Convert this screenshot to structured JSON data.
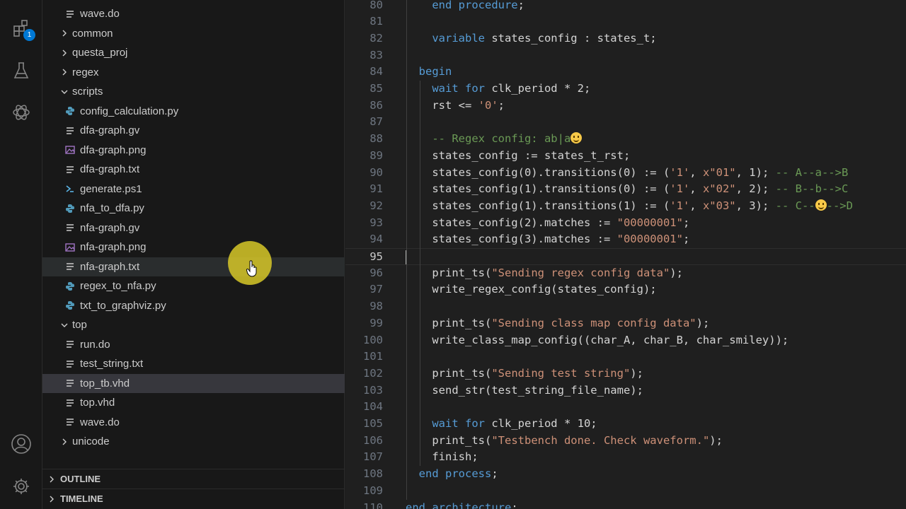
{
  "activity_bar": {
    "extensions_badge": "1",
    "icons": [
      "extensions-icon",
      "testing-icon",
      "chatgpt-icon",
      "account-icon",
      "settings-gear-icon"
    ]
  },
  "explorer": {
    "rows": [
      {
        "kind": "file",
        "icon": "lines",
        "name": "wave.do"
      },
      {
        "kind": "folder",
        "open": false,
        "name": "common"
      },
      {
        "kind": "folder",
        "open": false,
        "name": "questa_proj"
      },
      {
        "kind": "folder",
        "open": false,
        "name": "regex"
      },
      {
        "kind": "folder",
        "open": true,
        "name": "scripts"
      },
      {
        "kind": "file",
        "icon": "python",
        "name": "config_calculation.py"
      },
      {
        "kind": "file",
        "icon": "lines",
        "name": "dfa-graph.gv"
      },
      {
        "kind": "file",
        "icon": "image",
        "name": "dfa-graph.png"
      },
      {
        "kind": "file",
        "icon": "lines",
        "name": "dfa-graph.txt"
      },
      {
        "kind": "file",
        "icon": "powershell",
        "name": "generate.ps1"
      },
      {
        "kind": "file",
        "icon": "python",
        "name": "nfa_to_dfa.py"
      },
      {
        "kind": "file",
        "icon": "lines",
        "name": "nfa-graph.gv"
      },
      {
        "kind": "file",
        "icon": "image",
        "name": "nfa-graph.png"
      },
      {
        "kind": "file",
        "icon": "lines",
        "name": "nfa-graph.txt",
        "state": "hover"
      },
      {
        "kind": "file",
        "icon": "python",
        "name": "regex_to_nfa.py"
      },
      {
        "kind": "file",
        "icon": "python",
        "name": "txt_to_graphviz.py"
      },
      {
        "kind": "folder",
        "open": true,
        "name": "top"
      },
      {
        "kind": "file",
        "icon": "lines",
        "name": "run.do"
      },
      {
        "kind": "file",
        "icon": "lines",
        "name": "test_string.txt"
      },
      {
        "kind": "file",
        "icon": "lines",
        "name": "top_tb.vhd",
        "state": "selected"
      },
      {
        "kind": "file",
        "icon": "lines",
        "name": "top.vhd"
      },
      {
        "kind": "file",
        "icon": "lines",
        "name": "wave.do"
      },
      {
        "kind": "folder",
        "open": false,
        "name": "unicode"
      }
    ],
    "outline_label": "OUTLINE",
    "timeline_label": "TIMELINE"
  },
  "editor": {
    "current_line": 95,
    "lines": [
      {
        "n": "80",
        "indent": 2,
        "t": [
          [
            "kw",
            "end procedure"
          ],
          [
            "p",
            ";"
          ]
        ]
      },
      {
        "n": "81",
        "indent": 0,
        "t": []
      },
      {
        "n": "82",
        "indent": 2,
        "t": [
          [
            "kw",
            "variable"
          ],
          [
            "p",
            " states_config : states_t;"
          ]
        ]
      },
      {
        "n": "83",
        "indent": 0,
        "t": []
      },
      {
        "n": "84",
        "indent": 1,
        "t": [
          [
            "kw",
            "begin"
          ]
        ]
      },
      {
        "n": "85",
        "indent": 2,
        "t": [
          [
            "kw",
            "wait for"
          ],
          [
            "p",
            " clk_period * 2;"
          ]
        ]
      },
      {
        "n": "86",
        "indent": 2,
        "t": [
          [
            "p",
            "rst <= "
          ],
          [
            "str",
            "'0'"
          ],
          [
            "p",
            ";"
          ]
        ]
      },
      {
        "n": "87",
        "indent": 0,
        "t": []
      },
      {
        "n": "88",
        "indent": 2,
        "t": [
          [
            "cm",
            "-- Regex config: ab|a"
          ],
          [
            "emoji",
            ""
          ]
        ]
      },
      {
        "n": "89",
        "indent": 2,
        "t": [
          [
            "p",
            "states_config := states_t_rst;"
          ]
        ]
      },
      {
        "n": "90",
        "indent": 2,
        "t": [
          [
            "p",
            "states_config(0).transitions(0) := ("
          ],
          [
            "str",
            "'1'"
          ],
          [
            "p",
            ", "
          ],
          [
            "str",
            "x\"01\""
          ],
          [
            "p",
            ", 1); "
          ],
          [
            "cm",
            "-- A--a-->B"
          ]
        ]
      },
      {
        "n": "91",
        "indent": 2,
        "t": [
          [
            "p",
            "states_config(1).transitions(0) := ("
          ],
          [
            "str",
            "'1'"
          ],
          [
            "p",
            ", "
          ],
          [
            "str",
            "x\"02\""
          ],
          [
            "p",
            ", 2); "
          ],
          [
            "cm",
            "-- B--b-->C"
          ]
        ]
      },
      {
        "n": "92",
        "indent": 2,
        "t": [
          [
            "p",
            "states_config(1).transitions(1) := ("
          ],
          [
            "str",
            "'1'"
          ],
          [
            "p",
            ", "
          ],
          [
            "str",
            "x\"03\""
          ],
          [
            "p",
            ", 3); "
          ],
          [
            "cm",
            "-- C--"
          ],
          [
            "emoji",
            ""
          ],
          [
            "cm",
            "-->D"
          ]
        ]
      },
      {
        "n": "93",
        "indent": 2,
        "t": [
          [
            "p",
            "states_config(2).matches := "
          ],
          [
            "str",
            "\"00000001\""
          ],
          [
            "p",
            ";"
          ]
        ]
      },
      {
        "n": "94",
        "indent": 2,
        "t": [
          [
            "p",
            "states_config(3).matches := "
          ],
          [
            "str",
            "\"00000001\""
          ],
          [
            "p",
            ";"
          ]
        ]
      },
      {
        "n": "95",
        "indent": 0,
        "t": []
      },
      {
        "n": "96",
        "indent": 2,
        "t": [
          [
            "p",
            "print_ts("
          ],
          [
            "str",
            "\"Sending regex config data\""
          ],
          [
            "p",
            ");"
          ]
        ]
      },
      {
        "n": "97",
        "indent": 2,
        "t": [
          [
            "p",
            "write_regex_config(states_config);"
          ]
        ]
      },
      {
        "n": "98",
        "indent": 0,
        "t": []
      },
      {
        "n": "99",
        "indent": 2,
        "t": [
          [
            "p",
            "print_ts("
          ],
          [
            "str",
            "\"Sending class map config data\""
          ],
          [
            "p",
            ");"
          ]
        ]
      },
      {
        "n": "100",
        "indent": 2,
        "t": [
          [
            "p",
            "write_class_map_config((char_A, char_B, char_smiley));"
          ]
        ]
      },
      {
        "n": "101",
        "indent": 0,
        "t": []
      },
      {
        "n": "102",
        "indent": 2,
        "t": [
          [
            "p",
            "print_ts("
          ],
          [
            "str",
            "\"Sending test string\""
          ],
          [
            "p",
            ");"
          ]
        ]
      },
      {
        "n": "103",
        "indent": 2,
        "t": [
          [
            "p",
            "send_str(test_string_file_name);"
          ]
        ]
      },
      {
        "n": "104",
        "indent": 0,
        "t": []
      },
      {
        "n": "105",
        "indent": 2,
        "t": [
          [
            "kw",
            "wait for"
          ],
          [
            "p",
            " clk_period * 10;"
          ]
        ]
      },
      {
        "n": "106",
        "indent": 2,
        "t": [
          [
            "p",
            "print_ts("
          ],
          [
            "str",
            "\"Testbench done. Check waveform.\""
          ],
          [
            "p",
            ");"
          ]
        ]
      },
      {
        "n": "107",
        "indent": 2,
        "t": [
          [
            "p",
            "finish;"
          ]
        ]
      },
      {
        "n": "108",
        "indent": 1,
        "t": [
          [
            "kw",
            "end process"
          ],
          [
            "p",
            ";"
          ]
        ]
      },
      {
        "n": "109",
        "indent": 0,
        "t": []
      },
      {
        "n": "110",
        "indent": 0,
        "t": [
          [
            "kw",
            "end architecture"
          ],
          [
            "p",
            ";"
          ]
        ]
      }
    ]
  },
  "colors": {
    "keyword": "#569cd6",
    "string": "#ce9178",
    "comment": "#6a9955",
    "cursor_highlight": "#d7c828"
  }
}
